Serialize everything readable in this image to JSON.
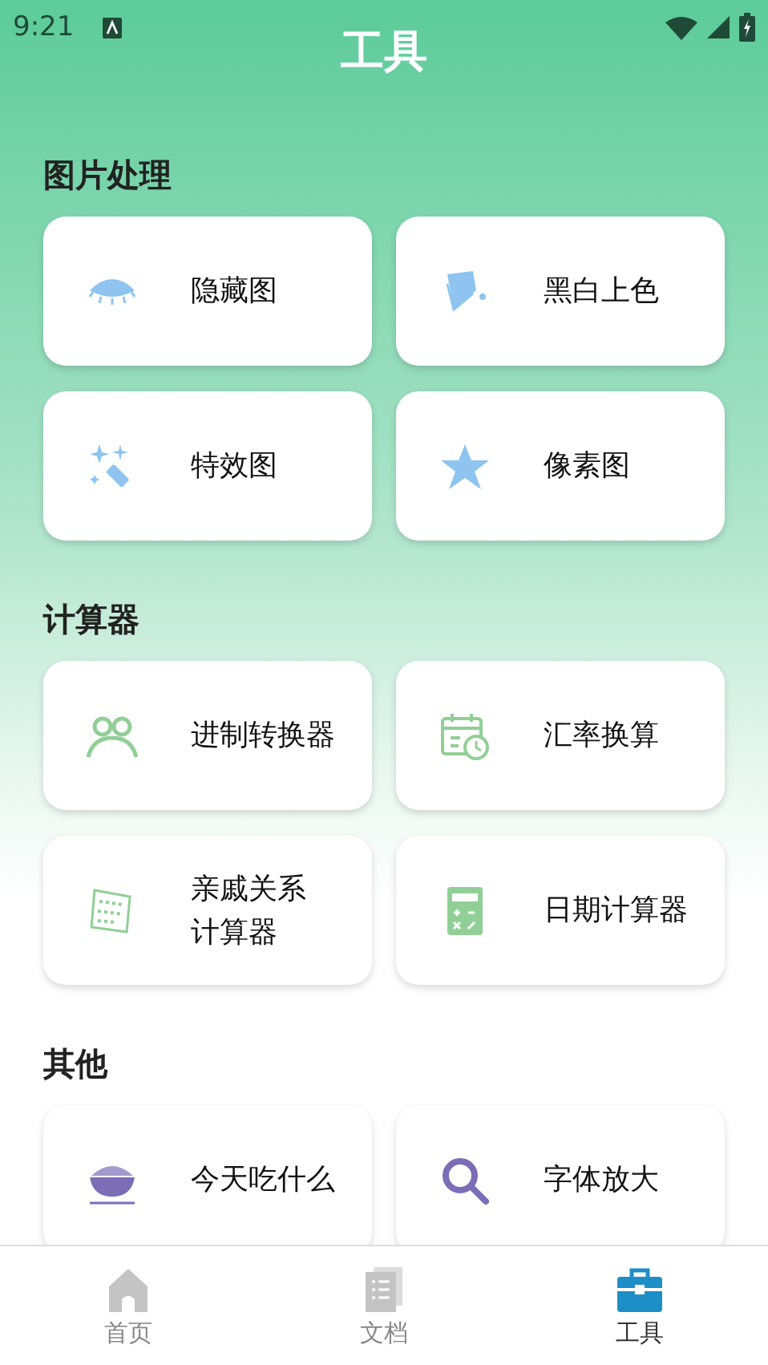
{
  "status_bar": {
    "time": "9:21"
  },
  "title": "工具",
  "sections": [
    {
      "title": "图片处理",
      "tools": [
        {
          "label": "隐藏图"
        },
        {
          "label": "黑白上色"
        },
        {
          "label": "特效图"
        },
        {
          "label": "像素图"
        }
      ]
    },
    {
      "title": "计算器",
      "tools": [
        {
          "label": "进制转换器"
        },
        {
          "label": "汇率换算"
        },
        {
          "lines": [
            "亲戚关系",
            "计算器"
          ]
        },
        {
          "label": "日期计算器"
        }
      ]
    },
    {
      "title": "其他",
      "tools": [
        {
          "label": "今天吃什么"
        },
        {
          "label": "字体放大"
        }
      ]
    }
  ],
  "bottom_nav": [
    {
      "label": "首页",
      "selected": false
    },
    {
      "label": "文档",
      "selected": false
    },
    {
      "label": "工具",
      "selected": true
    }
  ]
}
